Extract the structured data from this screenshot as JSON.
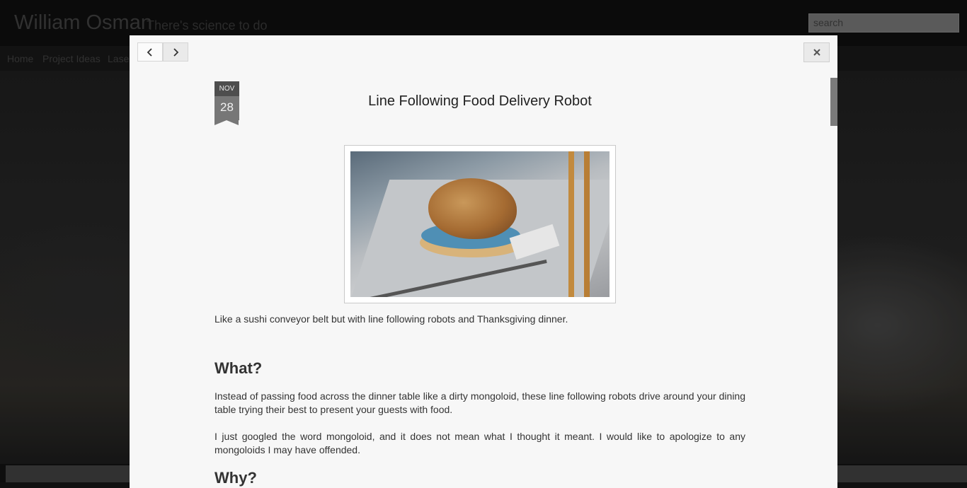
{
  "site": {
    "title": "William Osman",
    "tagline": "There's science to do",
    "search_placeholder": "search",
    "nav": [
      {
        "label": "Home"
      },
      {
        "label": "Project Ideas"
      },
      {
        "label": "Lase"
      }
    ]
  },
  "modal": {
    "prev_icon": "chevron-left-icon",
    "next_icon": "chevron-right-icon",
    "close_icon": "close-icon",
    "date": {
      "month": "NOV",
      "day": "28"
    },
    "title": "Line Following Food Delivery Robot",
    "intro": "Like a sushi conveyor belt but with line following robots and Thanksgiving dinner.",
    "sections": [
      {
        "heading": "What?",
        "paragraphs": [
          "Instead of passing food across the dinner table like a dirty mongoloid, these line following robots drive around your dining table trying their best to present your guests with food.",
          "I just googled the word mongoloid, and it does not mean what I thought it meant. I would like to apologize to any mongoloids I may have offended."
        ]
      },
      {
        "heading": "Why?",
        "paragraphs": []
      }
    ]
  }
}
